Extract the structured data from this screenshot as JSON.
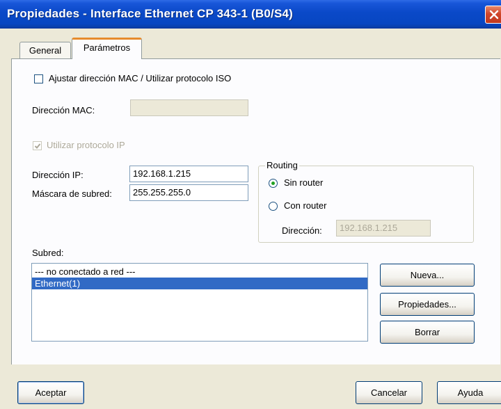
{
  "window": {
    "title": "Propiedades - Interface Ethernet  CP 343-1 (B0/S4)"
  },
  "tabs": [
    {
      "label": "General",
      "active": false
    },
    {
      "label": "Parámetros",
      "active": true
    }
  ],
  "mac": {
    "checkbox_label": "Ajustar dirección MAC / Utilizar protocolo ISO",
    "checked": false,
    "address_label": "Dirección MAC:",
    "address_value": ""
  },
  "ip": {
    "use_ip_label": "Utilizar protocolo IP",
    "use_ip_checked": true,
    "address_label": "Dirección IP:",
    "address_value": "192.168.1.215",
    "mask_label": "Máscara de subred:",
    "mask_value": "255.255.255.0"
  },
  "routing": {
    "group_label": "Routing",
    "no_router_label": "Sin router",
    "with_router_label": "Con router",
    "selected": "Sin router",
    "address_label": "Dirección:",
    "address_value": "192.168.1.215"
  },
  "subnet": {
    "label": "Subred:",
    "items": [
      {
        "label": "--- no conectado a red ---",
        "selected": false
      },
      {
        "label": "Ethernet(1)",
        "selected": true
      }
    ]
  },
  "side_buttons": {
    "new_label": "Nueva...",
    "properties_label": "Propiedades...",
    "delete_label": "Borrar"
  },
  "footer": {
    "ok_label": "Aceptar",
    "cancel_label": "Cancelar",
    "help_label": "Ayuda"
  },
  "colors": {
    "titlebar": "#0A49C8",
    "dialog_bg": "#ECE9D8",
    "selection": "#316AC5",
    "close_button": "#D0462B",
    "tab_highlight": "#E68B2C"
  }
}
